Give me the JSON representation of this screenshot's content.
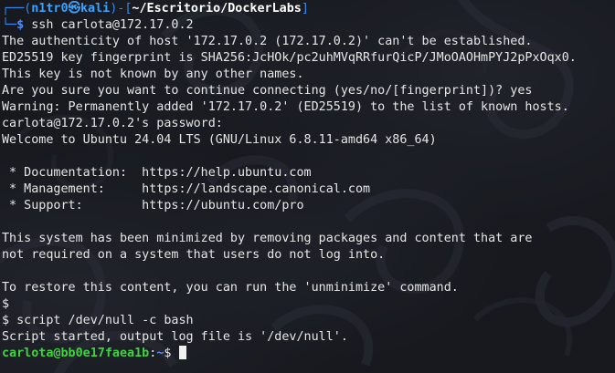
{
  "prompt": {
    "open": "┌──(",
    "user": "n1tr0",
    "at": "㉿",
    "host": "kali",
    "close": ")-[",
    "path": "~/Escritorio/DockerLabs",
    "path_close": "]",
    "second_prefix": "└─",
    "dollar": "$",
    "command": "ssh carlota@172.17.0.2"
  },
  "output": [
    "The authenticity of host '172.17.0.2 (172.17.0.2)' can't be established.",
    "ED25519 key fingerprint is SHA256:JcHOk/pc2uhMVqRRfurQicP/JMoOAOHmPYJ2pPxOqx0.",
    "This key is not known by any other names.",
    "Are you sure you want to continue connecting (yes/no/[fingerprint])? yes",
    "Warning: Permanently added '172.17.0.2' (ED25519) to the list of known hosts.",
    "carlota@172.17.0.2's password:",
    "Welcome to Ubuntu 24.04 LTS (GNU/Linux 6.8.11-amd64 x86_64)",
    "",
    " * Documentation:  https://help.ubuntu.com",
    " * Management:     https://landscape.canonical.com",
    " * Support:        https://ubuntu.com/pro",
    "",
    "This system has been minimized by removing packages and content that are",
    "not required on a system that users do not log into.",
    "",
    "To restore this content, you can run the 'unminimize' command.",
    "$",
    "$ script /dev/null -c bash",
    "Script started, output log file is '/dev/null'."
  ],
  "final_prompt": {
    "user_host": "carlota@bb0e17faea1b",
    "colon": ":",
    "path": "~",
    "dollar": "$ "
  },
  "colors": {
    "background": "#17191f",
    "prompt_frame": "#2f8cf0",
    "user_host": "#3aa2ff",
    "final_user": "#33d33a",
    "text": "#e6e6e6"
  }
}
